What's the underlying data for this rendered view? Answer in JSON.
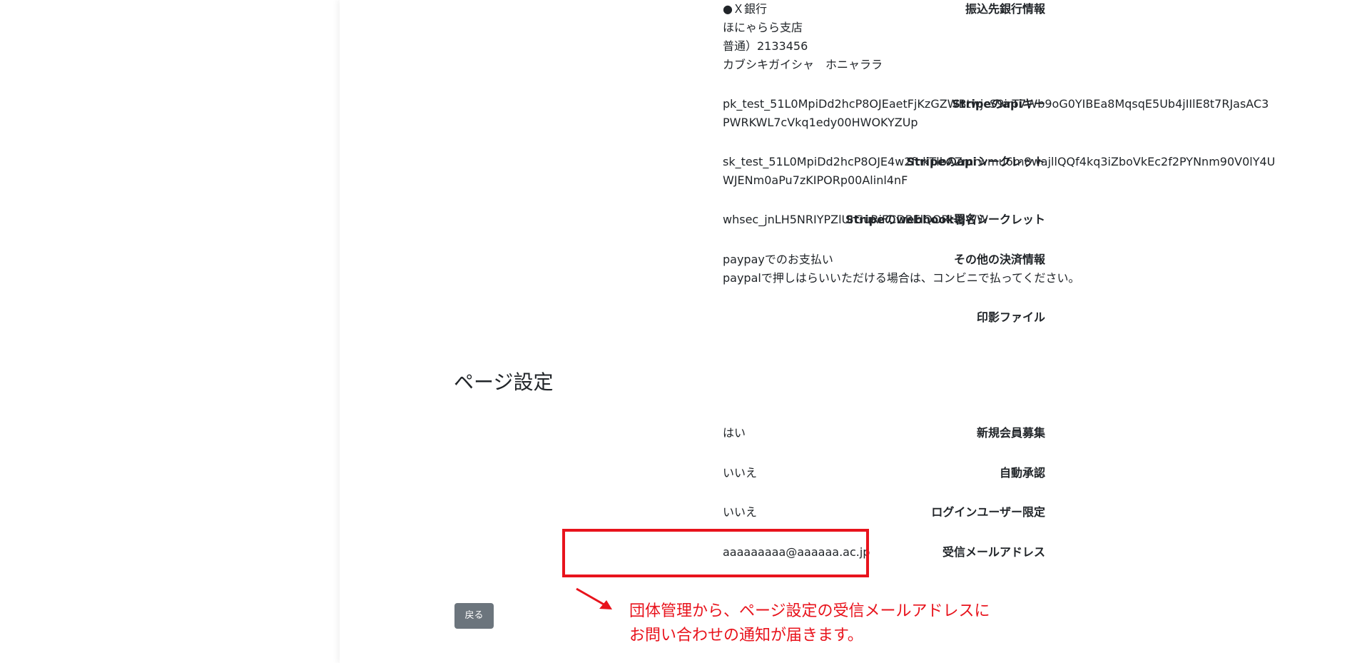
{
  "bank": {
    "label": "振込先銀行情報",
    "lines": [
      "●Ｘ銀行",
      "ほにゃらら支店",
      "普通）2133456",
      "カブシキガイシャ　ホニャララ"
    ]
  },
  "stripe_api_key": {
    "label": "Stripeのapiキー",
    "lines": [
      "pk_test_51L0MpiDd2hcP8OJEaetFjKzGZWBtwjcS9irT7Wb9oG0YIBEa8MqsqE5Ub4jIIlE8t7RJasAC3",
      "PWRKWL7cVkq1edy00HWOKYZUp"
    ]
  },
  "stripe_api_secret": {
    "label": "Stripeのapiシークレット",
    "lines": [
      "sk_test_51L0MpiDd2hcP8OJE4w2fnkTlbAZmrwmu6m8wajllQQf4kq3iZboVkEc2f2PYNnm90V0lY4U",
      "WJENm0aPu7zKIPORp00Alinl4nF"
    ]
  },
  "stripe_webhook": {
    "label": "Stripeのwebhook署名シークレット",
    "lines": [
      "whsec_jnLH5NRIYPZlUrGuRiFCDBElQORHtJWW"
    ]
  },
  "other_payment": {
    "label": "その他の決済情報",
    "lines": [
      "paypayでのお支払い",
      "paypalで押しはらいいただける場合は、コンビニで払ってください。"
    ]
  },
  "seal_file": {
    "label": "印影ファイル",
    "lines": []
  },
  "page_settings": {
    "title": "ページ設定",
    "new_member": {
      "label": "新規会員募集",
      "value": "はい"
    },
    "auto_approve": {
      "label": "自動承認",
      "value": "いいえ"
    },
    "login_only": {
      "label": "ログインユーザー限定",
      "value": "いいえ"
    },
    "receive_email": {
      "label": "受信メールアドレス",
      "value": "aaaaaaaaa@aaaaaa.ac.jp"
    }
  },
  "back_button": {
    "label": "戻る"
  },
  "annotation": {
    "line1": "団体管理から、ページ設定の受信メールアドレスに",
    "line2": "お問い合わせの通知が届きます。",
    "color": "#e8131c"
  },
  "colors": {
    "accent_red": "#e8131c",
    "button_gray": "#6c757d"
  }
}
